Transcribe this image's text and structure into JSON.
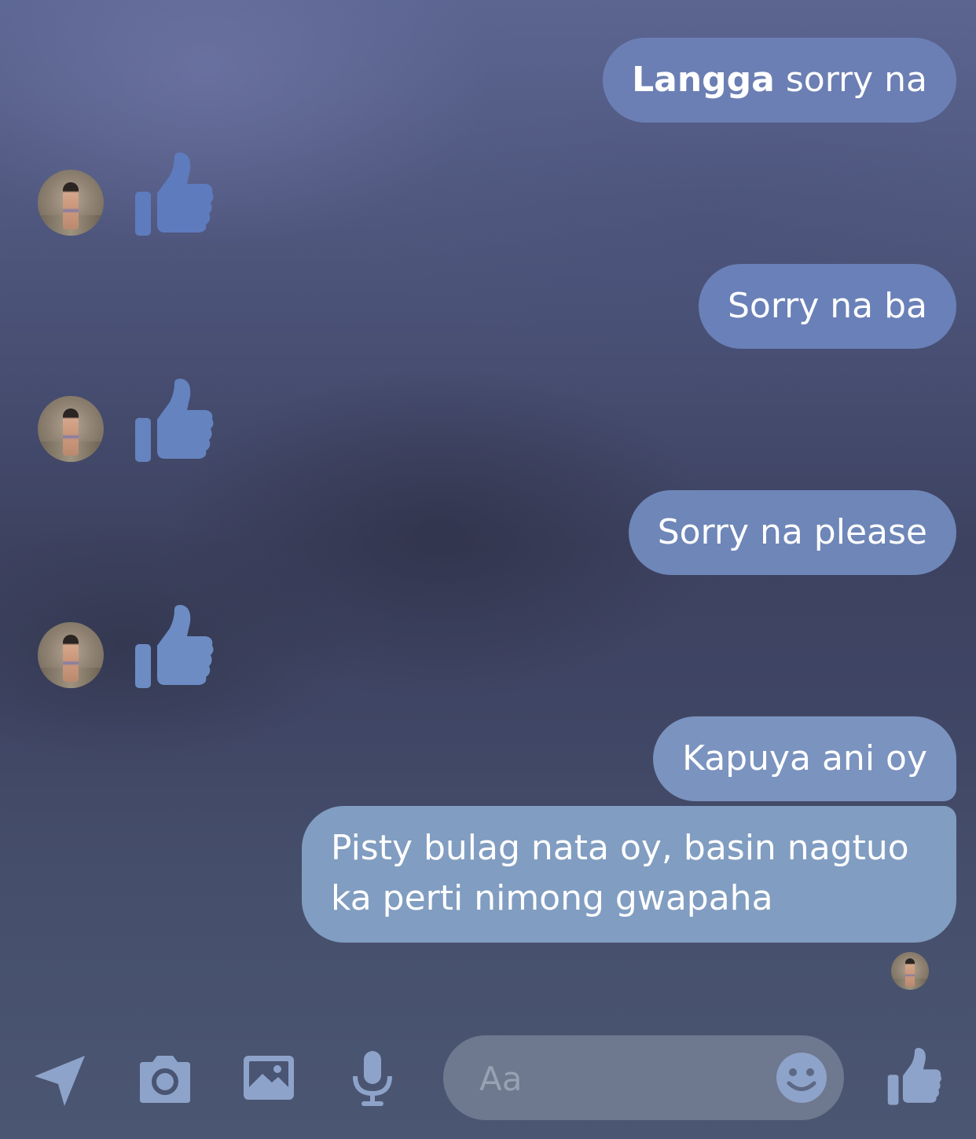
{
  "messages": {
    "m1": {
      "bold": "Langga",
      "rest": " sorry na"
    },
    "m2": "Sorry na ba",
    "m3": "Sorry na please",
    "m4": "Kapuya ani oy",
    "m5_line1": "Pisty bulag nata oy, basin nagtuo",
    "m5_line2": "ka perti nimong gwapaha"
  },
  "reactions": [
    "thumbs-up",
    "thumbs-up",
    "thumbs-up"
  ],
  "composer": {
    "placeholder": "Aa"
  },
  "icons": [
    "send-location-icon",
    "camera-icon",
    "gallery-icon",
    "microphone-icon",
    "emoji-icon",
    "like-icon"
  ],
  "colors": {
    "accent": "#6a80b8",
    "icon": "#7d96c9",
    "toolbar_icon": "#8ea3c9"
  }
}
